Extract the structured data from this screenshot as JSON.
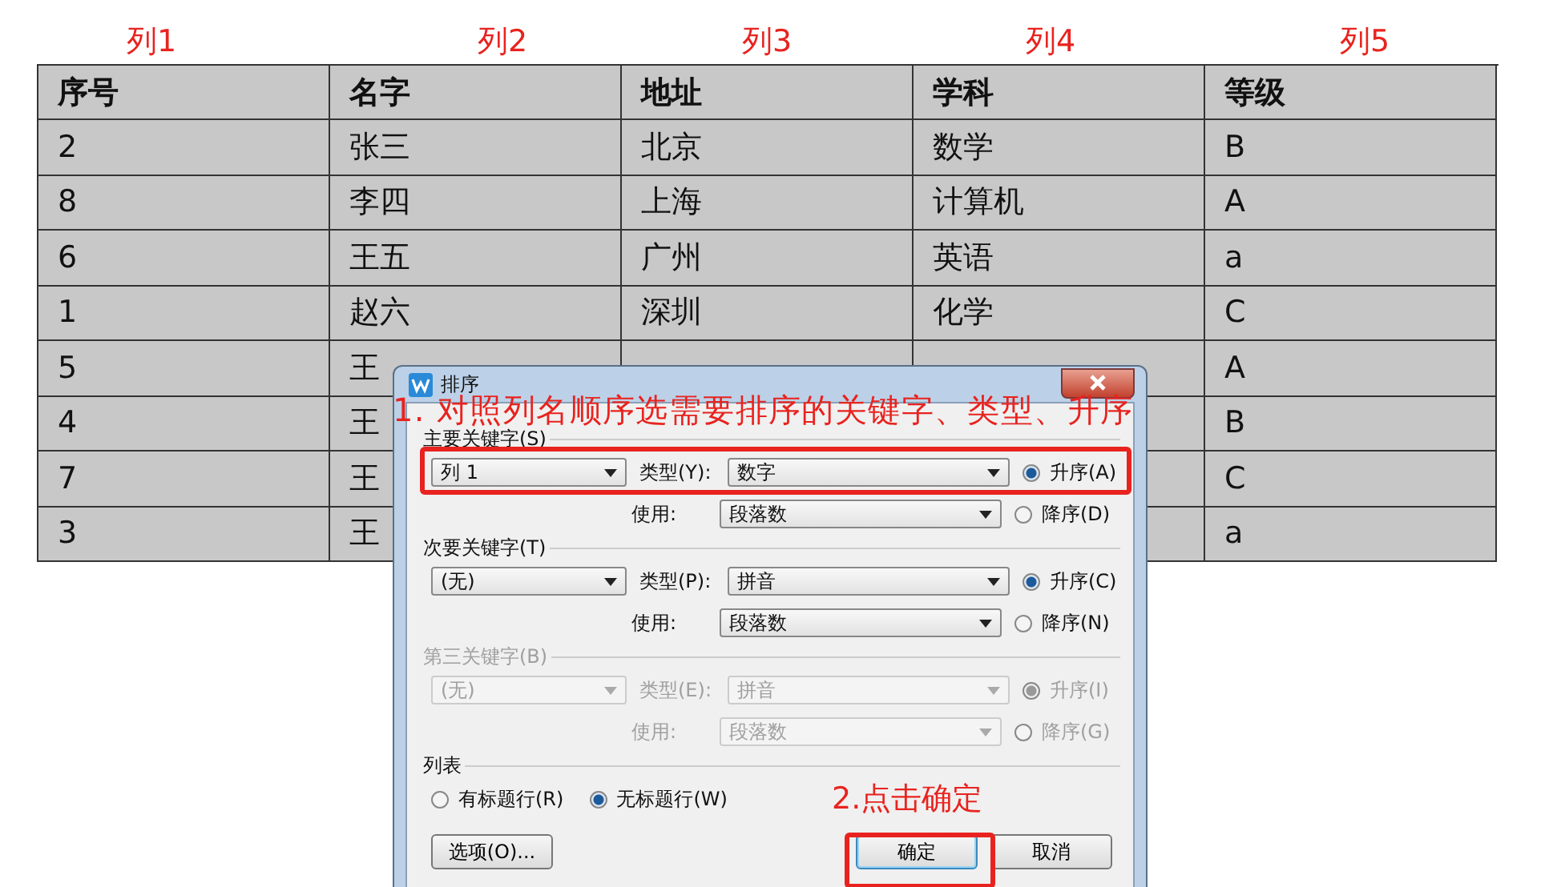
{
  "column_labels": [
    "列1",
    "列2",
    "列3",
    "列4",
    "列5"
  ],
  "table": {
    "columns": [
      "序号",
      "名字",
      "地址",
      "学科",
      "等级"
    ],
    "rows": [
      [
        "2",
        "张三",
        "北京",
        "数学",
        "B"
      ],
      [
        "8",
        "李四",
        "上海",
        "计算机",
        "A"
      ],
      [
        "6",
        "王五",
        "广州",
        "英语",
        "a"
      ],
      [
        "1",
        "赵六",
        "深圳",
        "化学",
        "C"
      ],
      [
        "5",
        "王",
        null,
        null,
        "A"
      ],
      [
        "4",
        "王",
        null,
        null,
        "B"
      ],
      [
        "7",
        "王",
        null,
        null,
        "C"
      ],
      [
        "3",
        "王",
        null,
        null,
        "a"
      ]
    ]
  },
  "dialog": {
    "title": "排序",
    "sections": [
      {
        "label": "主要关键字(S)",
        "disabled": false,
        "key": "列 1",
        "type_label": "类型(Y):",
        "type": "数字",
        "use_label": "使用:",
        "use": "段落数",
        "orders": [
          {
            "label": "升序(A)",
            "selected": true
          },
          {
            "label": "降序(D)",
            "selected": false
          }
        ]
      },
      {
        "label": "次要关键字(T)",
        "disabled": false,
        "key": "(无)",
        "type_label": "类型(P):",
        "type": "拼音",
        "use_label": "使用:",
        "use": "段落数",
        "orders": [
          {
            "label": "升序(C)",
            "selected": true
          },
          {
            "label": "降序(N)",
            "selected": false
          }
        ]
      },
      {
        "label": "第三关键字(B)",
        "disabled": true,
        "key": "(无)",
        "type_label": "类型(E):",
        "type": "拼音",
        "use_label": "使用:",
        "use": "段落数",
        "orders": [
          {
            "label": "升序(I)",
            "selected": true
          },
          {
            "label": "降序(G)",
            "selected": false
          }
        ]
      }
    ],
    "list_label": "列表",
    "header_options": [
      {
        "label": "有标题行(R)",
        "selected": false
      },
      {
        "label": "无标题行(W)",
        "selected": true
      }
    ],
    "buttons": [
      {
        "label": "选项(O)...",
        "focused": false
      },
      {
        "label": "确定",
        "focused": true
      },
      {
        "label": "取消",
        "focused": false
      }
    ]
  },
  "annotations": [
    "1. 对照列名顺序选需要排序的关键字、类型、升序",
    "2.点击确定"
  ]
}
